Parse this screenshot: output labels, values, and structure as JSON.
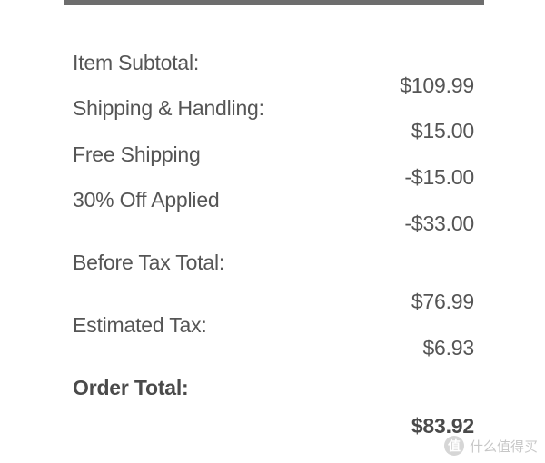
{
  "order_summary": {
    "rows": [
      {
        "label": "Item Subtotal:",
        "value": "$109.99"
      },
      {
        "label": "Shipping & Handling:",
        "value": "$15.00"
      },
      {
        "label": "Free Shipping",
        "value": "-$15.00"
      },
      {
        "label": "30% Off Applied",
        "value": "-$33.00"
      },
      {
        "label": "Before Tax Total:",
        "value": "$76.99"
      },
      {
        "label": "Estimated Tax:",
        "value": "$6.93"
      },
      {
        "label": "Order Total:",
        "value": "$83.92"
      }
    ]
  },
  "watermark": {
    "logo": "值",
    "text": "什么值得买"
  }
}
